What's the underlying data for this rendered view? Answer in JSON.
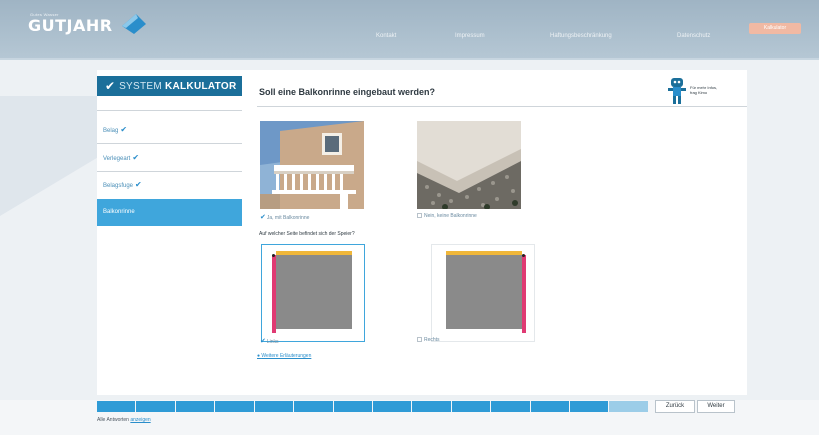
{
  "header": {
    "logo_small": "Gutes Wasser",
    "logo_text": "GUTJAHR",
    "nav": [
      {
        "label": "Kontakt"
      },
      {
        "label": "Impressum"
      },
      {
        "label": "Haftungsbeschränkung"
      },
      {
        "label": "Datenschutz"
      }
    ],
    "cta_label": "Kalkulator"
  },
  "sidebar": {
    "badge_light": "SYSTEM",
    "badge_bold": "KALKULATOR",
    "items": [
      {
        "label": "Belag",
        "done": true
      },
      {
        "label": "Verlegeart",
        "done": true
      },
      {
        "label": "Belagsfuge",
        "done": true
      },
      {
        "label": "Balkonrinne",
        "done": false,
        "active": true
      }
    ]
  },
  "main": {
    "title": "Soll eine Balkonrinne eingebaut werden?",
    "helper_text_1": "Für mehr Infos,",
    "helper_text_2": "frag Kimo",
    "options": [
      {
        "label": "Ja, mit Balkonrinne",
        "selected": true
      },
      {
        "label": "Nein, keine Balkonrinne",
        "selected": false
      }
    ],
    "question2": "Auf welcher Seite befindet sich der Speier?",
    "sides": [
      {
        "label": "Links",
        "selected": true
      },
      {
        "label": "Rechts",
        "selected": false
      }
    ],
    "info_link": "Weitere Erläuterungen"
  },
  "footer": {
    "progress_steps": 14,
    "progress_done": 13,
    "back_label": "Zurück",
    "next_label": "Weiter",
    "all_answers_prefix": "Alle Antworten",
    "all_answers_link": "anzeigen"
  },
  "colors": {
    "accent": "#3fa6dc",
    "badge": "#1b6f9a",
    "yellow": "#f0b73a",
    "pink": "#e03a73",
    "gray": "#8a8a8a"
  }
}
